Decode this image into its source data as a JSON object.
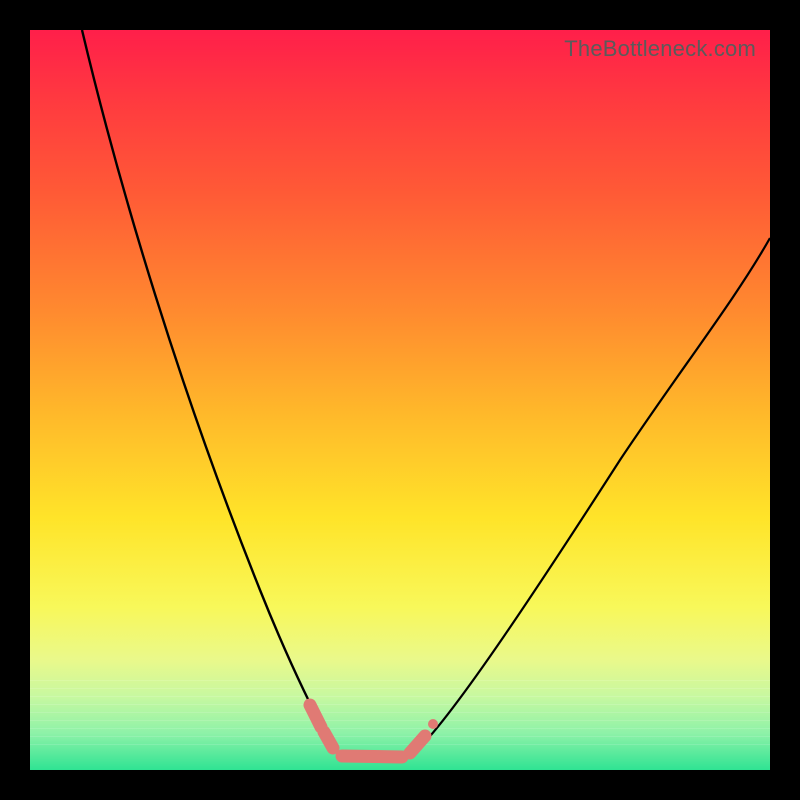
{
  "watermark": "TheBottleneck.com",
  "colors": {
    "background": "#000000",
    "gradient_top": "#ff1f4a",
    "gradient_bottom": "#2fe393",
    "curve": "#000000",
    "marker": "#e07a74"
  },
  "chart_data": {
    "type": "line",
    "title": "",
    "xlabel": "",
    "ylabel": "",
    "xlim": [
      0,
      100
    ],
    "ylim": [
      0,
      100
    ],
    "grid": false,
    "notes": "V-shaped bottleneck curve on red→green vertical gradient. No axis ticks or labels shown. Values estimated from pixel positions; 0 = bottom/green, 100 = top/red.",
    "series": [
      {
        "name": "left-branch",
        "x": [
          7,
          14,
          21,
          28,
          33,
          38,
          41
        ],
        "values": [
          100,
          80,
          58,
          36,
          18,
          6,
          2
        ]
      },
      {
        "name": "floor",
        "x": [
          41,
          46,
          52
        ],
        "values": [
          2,
          1,
          2
        ]
      },
      {
        "name": "right-branch",
        "x": [
          52,
          60,
          70,
          80,
          90,
          100
        ],
        "values": [
          2,
          10,
          25,
          42,
          58,
          72
        ]
      }
    ],
    "markers": [
      {
        "name": "left-tick-top",
        "x": 38.5,
        "y": 6
      },
      {
        "name": "left-tick-bottom",
        "x": 40.5,
        "y": 3
      },
      {
        "name": "floor-segment",
        "x": 46,
        "y": 1
      },
      {
        "name": "right-tick",
        "x": 53,
        "y": 3
      }
    ]
  }
}
